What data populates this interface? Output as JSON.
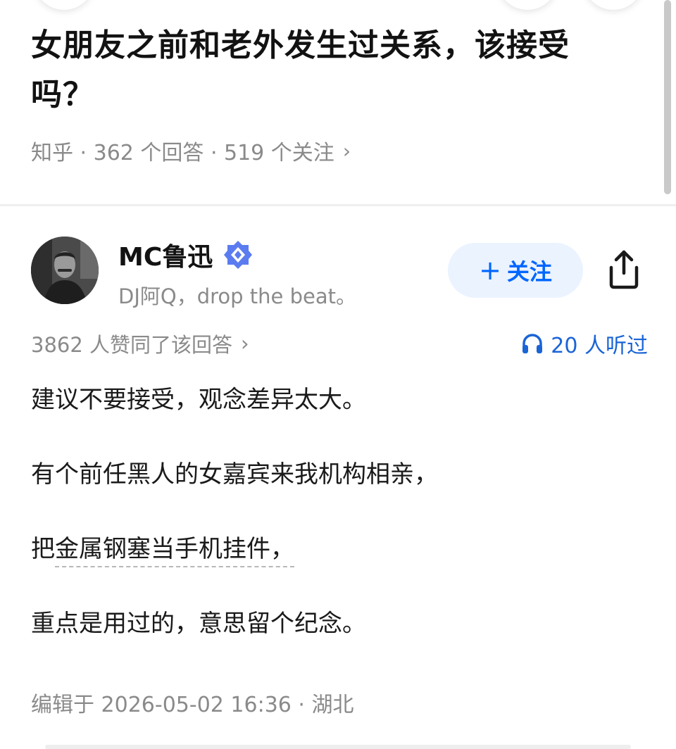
{
  "question": {
    "title_line1": "女朋友之前和老外发生过关系，该接受",
    "title_line2": "吗？",
    "meta": "知乎 · 362 个回答 · 519 个关注",
    "meta_chevron": "›"
  },
  "author": {
    "name": "MC鲁迅",
    "bio": "DJ阿Q，drop the beat。",
    "avatar_icon": "avatar-portrait",
    "verified_icon": "verified-badge-icon",
    "follow_plus": "+",
    "follow_label": "关注",
    "share_icon": "share-icon"
  },
  "stats": {
    "upvotes": "3862 人赞同了该回答",
    "upvotes_chevron": "›",
    "listened": "20 人听过",
    "listened_icon": "headphone-icon"
  },
  "content": {
    "p1": "建议不要接受，观念差异太大。",
    "p2": "有个前任黑人的女嘉宾来我机构相亲，",
    "p3_prefix": "把",
    "p3_link": "金属钢塞当手机挂件，",
    "p4": "重点是用过的，意思留个纪念。"
  },
  "footer": {
    "edited": "编辑于 2026-05-02 16:36 · 湖北"
  },
  "colors": {
    "accent": "#0066ff",
    "follow_bg": "#ebf3ff",
    "muted": "#8a8a8a",
    "verified": "#4c6ef5"
  }
}
